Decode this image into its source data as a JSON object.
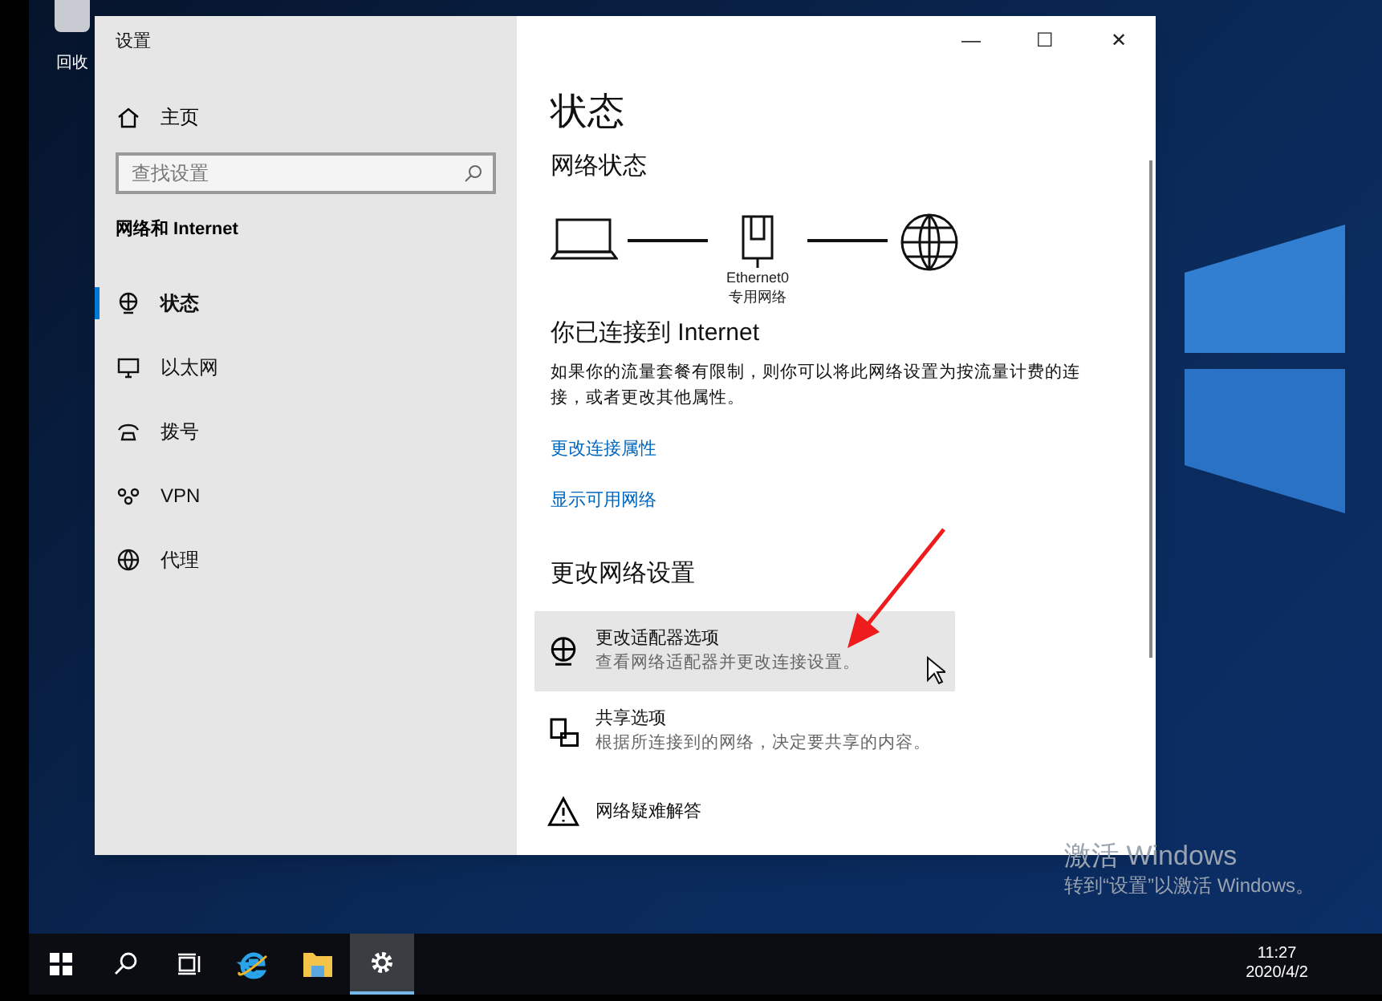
{
  "desktop": {
    "recycle_bin_label": "回收",
    "activation": {
      "title": "激活 Windows",
      "subtitle": "转到“设置”以激活 Windows。"
    }
  },
  "window": {
    "title": "设置",
    "controls": [
      "—",
      "☐",
      "✕"
    ]
  },
  "sidebar": {
    "home": "主页",
    "search": {
      "placeholder": "查找设置"
    },
    "section": "网络和 Internet",
    "items": [
      {
        "label": "状态",
        "kind": "status",
        "selected": true
      },
      {
        "label": "以太网",
        "kind": "ethernet",
        "selected": false
      },
      {
        "label": "拨号",
        "kind": "dialup",
        "selected": false
      },
      {
        "label": "VPN",
        "kind": "vpn",
        "selected": false
      },
      {
        "label": "代理",
        "kind": "proxy",
        "selected": false
      }
    ]
  },
  "content": {
    "title": "状态",
    "network_heading": "网络状态",
    "adapter_name": "Ethernet0",
    "network_type": "专用网络",
    "connected": "你已连接到 Internet",
    "description": "如果你的流量套餐有限制，则你可以将此网络设置为按流量计费的连接，或者更改其他属性。",
    "links": [
      "更改连接属性",
      "显示可用网络"
    ],
    "change_heading": "更改网络设置",
    "options": [
      {
        "kind": "adapter",
        "title": "更改适配器选项",
        "subtitle": "查看网络适配器并更改连接设置。",
        "hovered": true
      },
      {
        "kind": "sharing",
        "title": "共享选项",
        "subtitle": "根据所连接到的网络，决定要共享的内容。",
        "hovered": false
      },
      {
        "kind": "troubleshoot",
        "title": "网络疑难解答",
        "hovered": false
      }
    ]
  },
  "taskbar": {
    "apps": [
      {
        "kind": "start",
        "selected": false
      },
      {
        "kind": "search",
        "selected": false
      },
      {
        "kind": "taskview",
        "selected": false
      },
      {
        "kind": "browser",
        "selected": false
      },
      {
        "kind": "folder",
        "selected": false
      },
      {
        "kind": "settings",
        "selected": true
      }
    ],
    "time": "11:27",
    "date": "2020/4/2"
  }
}
